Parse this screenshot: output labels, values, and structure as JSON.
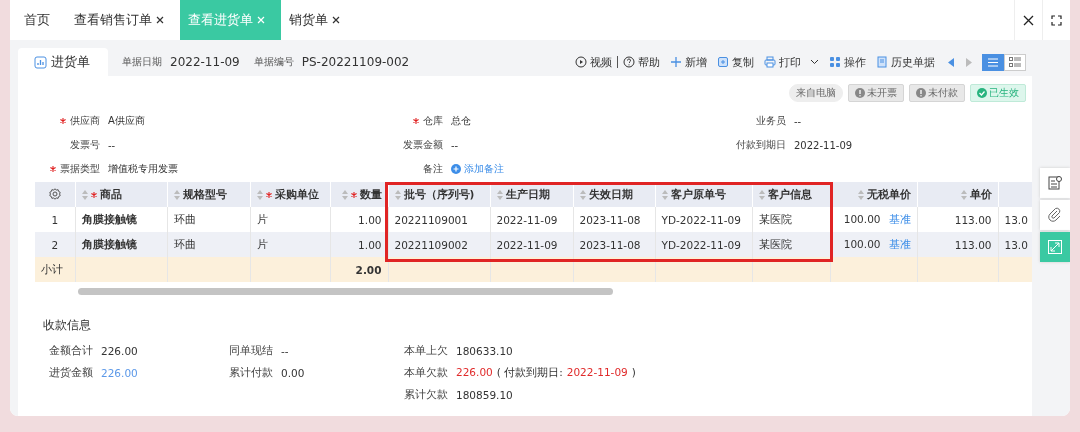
{
  "tabs": [
    {
      "label": "首页",
      "closable": false,
      "selected": false
    },
    {
      "label": "查看销售订单",
      "closable": true,
      "selected": false
    },
    {
      "label": "查看进货单",
      "closable": true,
      "selected": true
    },
    {
      "label": "销货单",
      "closable": true,
      "selected": false
    }
  ],
  "document": {
    "title": "进货单",
    "fields": [
      {
        "label": "单据日期",
        "value": "2022-11-09"
      },
      {
        "label": "单据编号",
        "value": "PS-20221109-002"
      }
    ]
  },
  "toolbar": [
    {
      "label": "视频",
      "kind": "video"
    },
    {
      "label": "帮助",
      "kind": "help"
    },
    {
      "label": "新增",
      "kind": "add"
    },
    {
      "label": "复制",
      "kind": "copy"
    },
    {
      "label": "打印",
      "kind": "print"
    },
    {
      "label": "操作",
      "kind": "apps"
    },
    {
      "label": "历史单据",
      "kind": "history"
    }
  ],
  "views": [
    {
      "kind": "list",
      "selected": true
    },
    {
      "kind": "detail",
      "selected": false
    }
  ],
  "badges": [
    {
      "label": "来自电脑",
      "kind": "source"
    },
    {
      "label": "未开票",
      "kind": "pending"
    },
    {
      "label": "未付款",
      "kind": "pending"
    },
    {
      "label": "已生效",
      "kind": "done"
    }
  ],
  "form": {
    "rows": [
      [
        {
          "label": "供应商",
          "value": "A供应商",
          "required": true
        },
        {
          "label": "仓库",
          "value": "总仓",
          "required": true
        },
        {
          "label": "业务员",
          "value": "--",
          "required": false
        }
      ],
      [
        {
          "label": "发票号",
          "value": "--",
          "required": false
        },
        {
          "label": "发票金额",
          "value": "--",
          "required": false
        },
        {
          "label": "付款到期日",
          "value": "2022-11-09",
          "required": false
        }
      ],
      [
        {
          "label": "票据类型",
          "value": "增值税专用发票",
          "required": true
        },
        {
          "label": "备注",
          "link": "添加备注",
          "required": false
        }
      ]
    ]
  },
  "table": {
    "columns": [
      {
        "label": "商品",
        "required": true,
        "kind": "text"
      },
      {
        "label": "规格型号",
        "kind": "text"
      },
      {
        "label": "采购单位",
        "required": true,
        "kind": "text"
      },
      {
        "label": "数量",
        "required": true,
        "kind": "number"
      },
      {
        "label": "批号（序列号)",
        "highlighted": true,
        "kind": "text"
      },
      {
        "label": "生产日期",
        "highlighted": true,
        "kind": "text"
      },
      {
        "label": "失效日期",
        "highlighted": true,
        "kind": "text"
      },
      {
        "label": "客户原单号",
        "highlighted": true,
        "kind": "text"
      },
      {
        "label": "客户信息",
        "highlighted": true,
        "kind": "text"
      },
      {
        "label": "无税单价",
        "kind": "number"
      },
      {
        "label": "单价",
        "kind": "number"
      },
      {
        "kind": "text"
      }
    ],
    "rows": [
      {
        "index": "1",
        "cells": [
          {
            "text": "角膜接触镜"
          },
          {
            "text": "环曲"
          },
          {
            "text": "片"
          },
          {
            "text": "1.00"
          },
          {
            "text": "20221109001"
          },
          {
            "text": "2022-11-09"
          },
          {
            "text": "2023-11-08"
          },
          {
            "text": "YD-2022-11-09"
          },
          {
            "text": "某医院"
          },
          {
            "text": "100.00",
            "link": "基准"
          },
          {
            "text": "113.00"
          },
          {
            "text": "13.0"
          }
        ]
      },
      {
        "index": "2",
        "cells": [
          {
            "text": "角膜接触镜"
          },
          {
            "text": "环曲"
          },
          {
            "text": "片"
          },
          {
            "text": "1.00"
          },
          {
            "text": "20221109002"
          },
          {
            "text": "2022-11-09"
          },
          {
            "text": "2023-11-08"
          },
          {
            "text": "YD-2022-11-09"
          },
          {
            "text": "某医院"
          },
          {
            "text": "100.00",
            "link": "基准"
          },
          {
            "text": "113.00"
          },
          {
            "text": "13.0"
          }
        ]
      }
    ],
    "subtotal": {
      "label": "小计",
      "quantity": "2.00"
    }
  },
  "payment": {
    "title": "收款信息",
    "columns": [
      [
        {
          "label": "金额合计",
          "parts": [
            {
              "text": "226.00"
            }
          ]
        },
        {
          "label": "进货金额",
          "parts": [
            {
              "text": "226.00",
              "color": "#5b98e8"
            }
          ]
        }
      ],
      [
        {
          "label": "同单现结",
          "parts": [
            {
              "text": "--"
            }
          ]
        },
        {
          "label": "累计付款",
          "parts": [
            {
              "text": "0.00"
            }
          ]
        }
      ],
      [
        {
          "label": "本单上欠",
          "parts": [
            {
              "text": "180633.10"
            }
          ]
        },
        {
          "label": "本单欠款",
          "parts": [
            {
              "text": "226.00",
              "color": "#e02a2a"
            },
            {
              "text": "( 付款到期日:"
            },
            {
              "text": "2022-11-09",
              "color": "#e02a2a"
            },
            {
              "text": ")"
            }
          ]
        },
        {
          "label": "累计欠款",
          "parts": [
            {
              "text": "180859.10"
            }
          ]
        }
      ]
    ]
  }
}
